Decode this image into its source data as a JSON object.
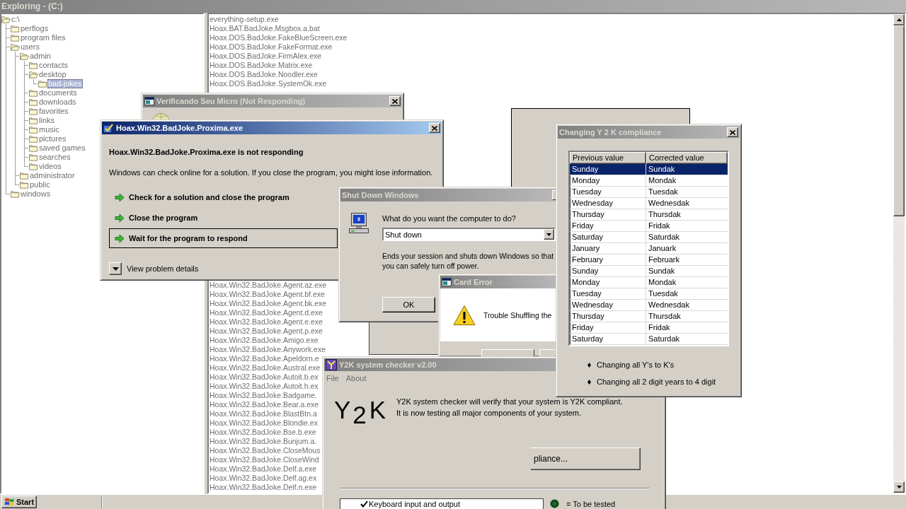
{
  "explorer": {
    "title": "Exploring - (C:)",
    "active": false,
    "tree": [
      {
        "label": "c:\\",
        "expanded": true,
        "selected": false,
        "children": [
          {
            "label": "perflogs",
            "expanded": false,
            "selected": false
          },
          {
            "label": "program files",
            "expanded": false,
            "selected": false
          },
          {
            "label": "users",
            "expanded": true,
            "selected": false,
            "children": [
              {
                "label": "admin",
                "expanded": true,
                "selected": false,
                "children": [
                  {
                    "label": "contacts",
                    "expanded": false,
                    "selected": false
                  },
                  {
                    "label": "desktop",
                    "expanded": true,
                    "selected": false,
                    "children": [
                      {
                        "label": "bad-jokes",
                        "expanded": false,
                        "selected": true
                      }
                    ]
                  },
                  {
                    "label": "documents",
                    "expanded": false,
                    "selected": false
                  },
                  {
                    "label": "downloads",
                    "expanded": false,
                    "selected": false
                  },
                  {
                    "label": "favorites",
                    "expanded": false,
                    "selected": false
                  },
                  {
                    "label": "links",
                    "expanded": false,
                    "selected": false
                  },
                  {
                    "label": "music",
                    "expanded": false,
                    "selected": false
                  },
                  {
                    "label": "pictures",
                    "expanded": false,
                    "selected": false
                  },
                  {
                    "label": "saved games",
                    "expanded": false,
                    "selected": false
                  },
                  {
                    "label": "searches",
                    "expanded": false,
                    "selected": false
                  },
                  {
                    "label": "videos",
                    "expanded": false,
                    "selected": false
                  }
                ]
              },
              {
                "label": "administrator",
                "expanded": false,
                "selected": false
              },
              {
                "label": "public",
                "expanded": false,
                "selected": false
              }
            ]
          },
          {
            "label": "windows",
            "expanded": false,
            "selected": false
          }
        ]
      }
    ],
    "files_top": [
      "everything-setup.exe",
      "Hoax.BAT.BadJoke.Msgbox.a.bat",
      "Hoax.DOS.BadJoke.FakeBlueScreen.exe",
      "Hoax.DOS.BadJoke.FakeFormat.exe",
      "Hoax.DOS.BadJoke.FirmAlex.exe",
      "Hoax.DOS.BadJoke.Matrix.exe",
      "Hoax.DOS.BadJoke.Noodler.exe",
      "Hoax.DOS.BadJoke.SystemOk.exe"
    ],
    "files_bottom": [
      "Hoax.Win32.BadJoke.Agent.az.exe",
      "Hoax.Win32.BadJoke.Agent.bf.exe",
      "Hoax.Win32.BadJoke.Agent.bk.exe",
      "Hoax.Win32.BadJoke.Agent.d.exe",
      "Hoax.Win32.BadJoke.Agent.e.exe",
      "Hoax.Win32.BadJoke.Agent.p.exe",
      "Hoax.Win32.BadJoke.Amigo.exe",
      "Hoax.Win32.BadJoke.Anywork.exe",
      "Hoax.Win32.BadJoke.Apeldorn.e",
      "Hoax.Win32.BadJoke.Austral.exe",
      "Hoax.Win32.BadJoke.Autoit.b.ex",
      "Hoax.Win32.BadJoke.Autoit.h.ex",
      "Hoax.Win32.BadJoke.Badgame.",
      "Hoax.Win32.BadJoke.Bear.a.exe",
      "Hoax.Win32.BadJoke.BlastBtn.a",
      "Hoax.Win32.BadJoke.Blondie.ex",
      "Hoax.Win32.BadJoke.Bse.b.exe",
      "Hoax.Win32.BadJoke.Bunjum.a.",
      "Hoax.Win32.BadJoke.CloseMous",
      "Hoax.Win32.BadJoke.CloseWind",
      "Hoax.Win32.BadJoke.Delf.a.exe",
      "Hoax.Win32.BadJoke.Delf.ag.ex",
      "Hoax.Win32.BadJoke.Delf.n.exe"
    ]
  },
  "verificando": {
    "title": "Verificando Seu Micro (Not Responding)",
    "active": false
  },
  "proxima": {
    "title": "Hoax.Win32.BadJoke.Proxima.exe",
    "active": true,
    "heading": "Hoax.Win32.BadJoke.Proxima.exe is not responding",
    "message": "Windows can check online for a solution. If you close the program, you might lose information.",
    "options": [
      {
        "label": "Check for a solution and close the program",
        "selected": false
      },
      {
        "label": "Close the program",
        "selected": false
      },
      {
        "label": "Wait for the program to respond",
        "selected": true
      }
    ],
    "details": "View problem details"
  },
  "shutdown": {
    "title": "Shut Down Windows",
    "active": false,
    "prompt": "What do you want the computer to do?",
    "choice": "Shut down",
    "description": "Ends your session and shuts down Windows so that you can safely turn off power.",
    "ok": "OK"
  },
  "card_error": {
    "title": "Card Error",
    "active": false,
    "message": "Trouble Shuffling the"
  },
  "y2k_checker": {
    "title": "Y2K system checker v2.00",
    "active": false,
    "menu": [
      "File",
      "About"
    ],
    "logo": "Y$_{2}$K",
    "intro": [
      "Y2K system checker will verify that your system is Y2K compliant.",
      "It is now testing all major components of your system."
    ],
    "action": "pliance...",
    "tests": [
      {
        "label": "Keyboard input and output",
        "checked": true
      }
    ],
    "legend": "= To be tested"
  },
  "y2k_compliance": {
    "title": "Changing Y 2 K compliance",
    "active": false,
    "columns": [
      "Previous value",
      "Corrected value"
    ],
    "rows": [
      {
        "cells": [
          "Sunday",
          "Sundak"
        ],
        "selected": true
      },
      {
        "cells": [
          "Monday",
          "Mondak"
        ],
        "selected": false
      },
      {
        "cells": [
          "Tuesday",
          "Tuesdak"
        ],
        "selected": false
      },
      {
        "cells": [
          "Wednesday",
          "Wednesdak"
        ],
        "selected": false
      },
      {
        "cells": [
          "Thursday",
          "Thursdak"
        ],
        "selected": false
      },
      {
        "cells": [
          "Friday",
          "Fridak"
        ],
        "selected": false
      },
      {
        "cells": [
          "Saturday",
          "Saturdak"
        ],
        "selected": false
      },
      {
        "cells": [
          "January",
          "Januark"
        ],
        "selected": false
      },
      {
        "cells": [
          "February",
          "Februark"
        ],
        "selected": false
      },
      {
        "cells": [
          "Sunday",
          "Sundak"
        ],
        "selected": false
      },
      {
        "cells": [
          "Monday",
          "Mondak"
        ],
        "selected": false
      },
      {
        "cells": [
          "Tuesday",
          "Tuesdak"
        ],
        "selected": false
      },
      {
        "cells": [
          "Wednesday",
          "Wednesdak"
        ],
        "selected": false
      },
      {
        "cells": [
          "Thursday",
          "Thursdak"
        ],
        "selected": false
      },
      {
        "cells": [
          "Friday",
          "Fridak"
        ],
        "selected": false
      },
      {
        "cells": [
          "Saturday",
          "Saturdak"
        ],
        "selected": false
      }
    ],
    "notes": [
      "Changing all Y's to K's",
      "Changing all 2 digit years to 4 digit"
    ]
  },
  "taskbar": {
    "start": "Start"
  }
}
